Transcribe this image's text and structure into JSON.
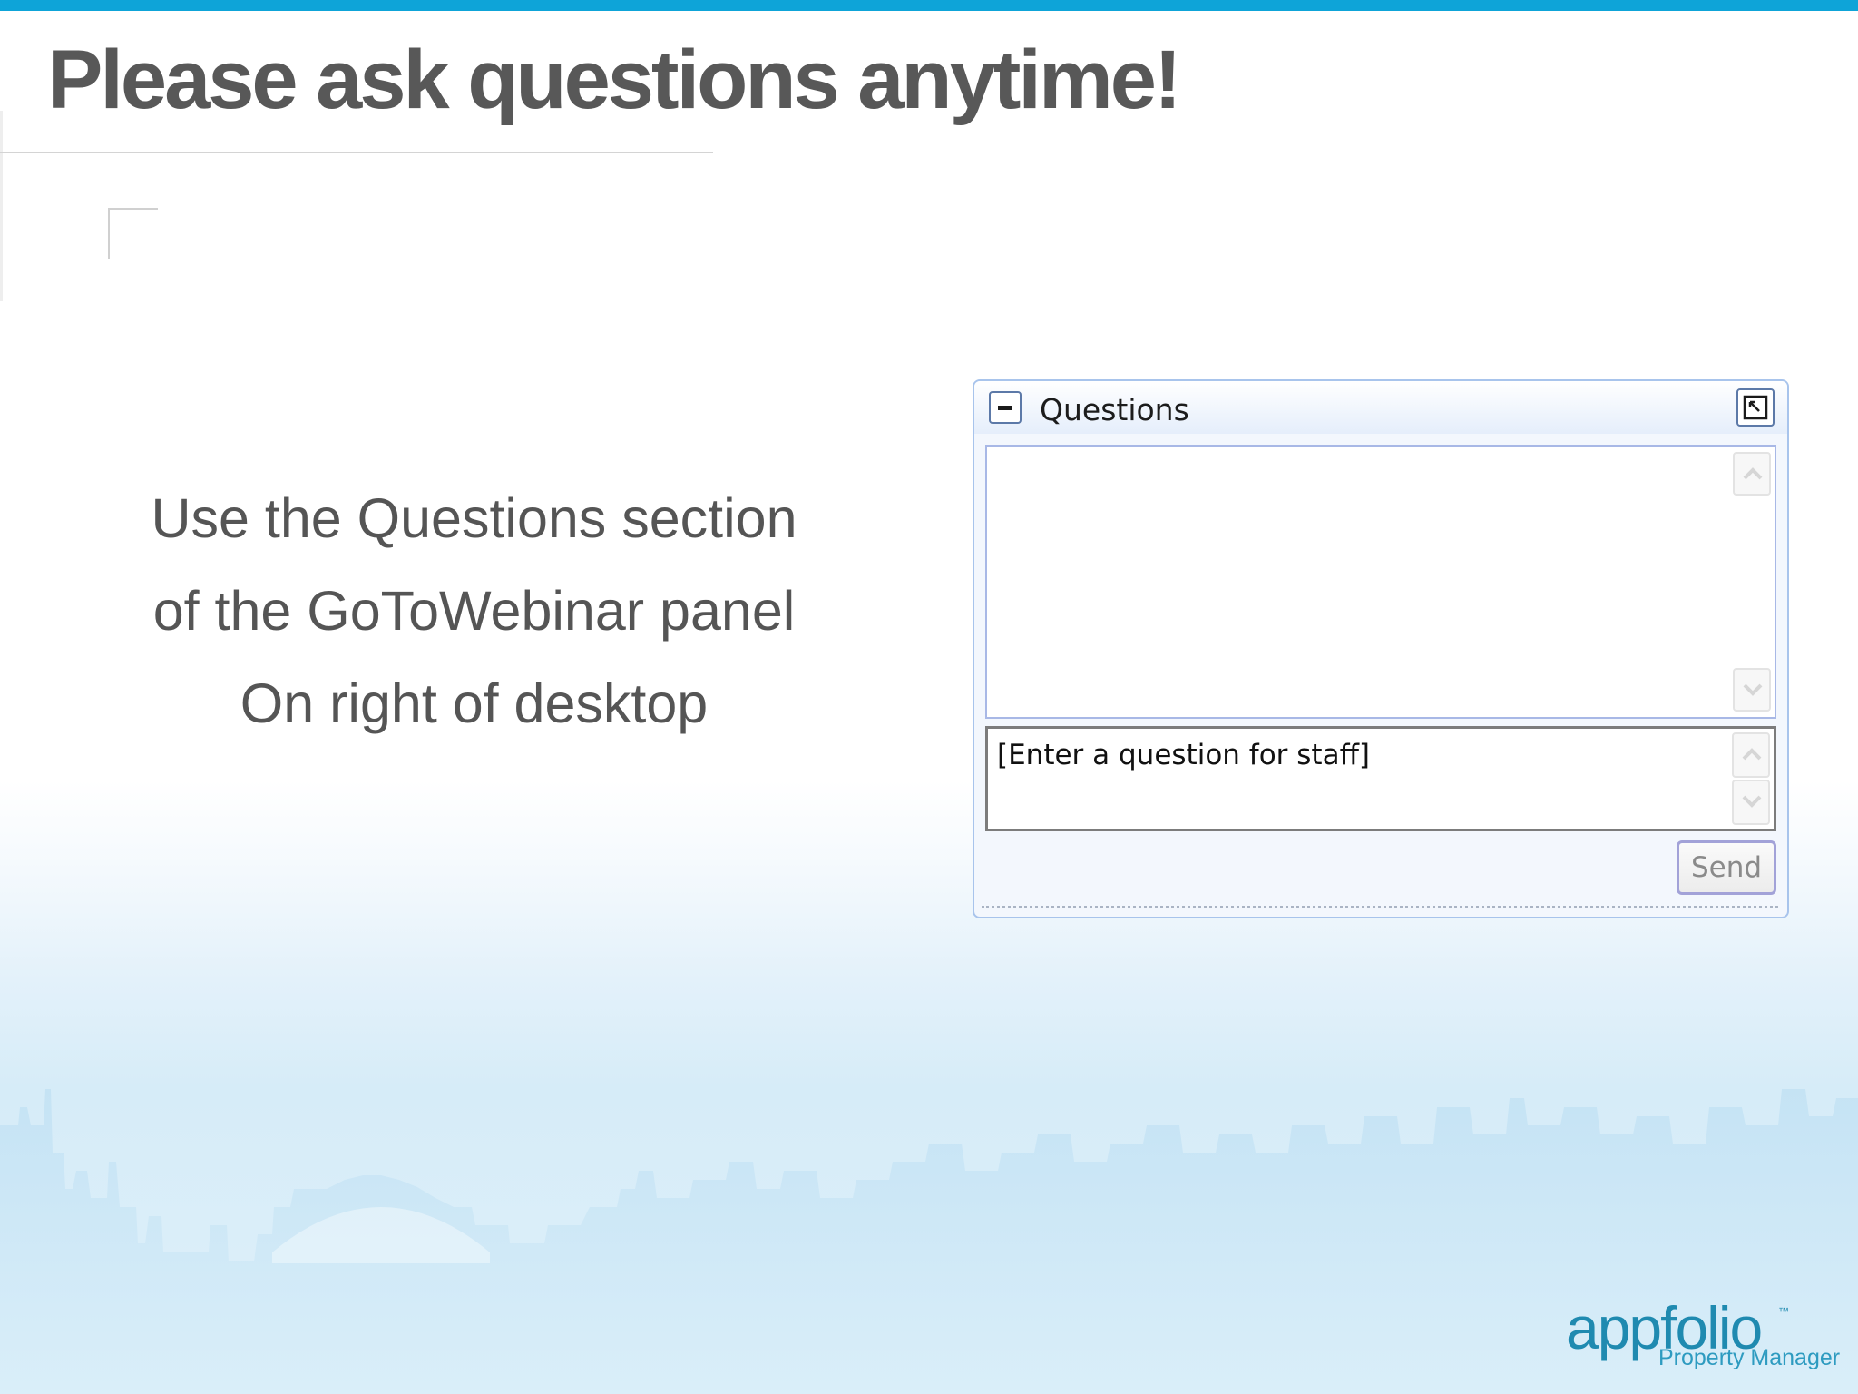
{
  "slide": {
    "title": "Please ask questions anytime!",
    "body_lines": [
      "Use the Questions section",
      "of the GoToWebinar panel",
      "On right of desktop"
    ]
  },
  "questions_panel": {
    "title": "Questions",
    "input_placeholder": "[Enter a question for staff]",
    "send_label": "Send"
  },
  "logo": {
    "brand": "appfolio",
    "trademark": "™",
    "product": "Property Manager"
  },
  "colors": {
    "accent_bar": "#0ea4d8",
    "title_text": "#585858",
    "panel_border": "#a8c4ec",
    "logo": "#1f8ab0"
  }
}
